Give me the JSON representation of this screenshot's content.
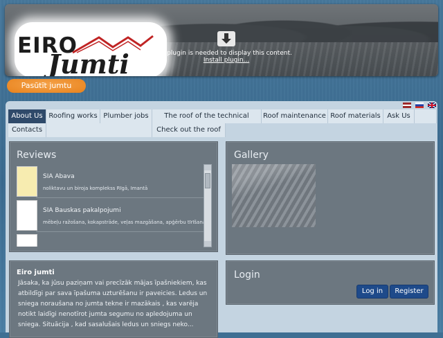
{
  "header": {
    "logo_top": "EIRO",
    "logo_bottom": "Jumti",
    "plugin_message": "A plugin is needed to display this content.",
    "plugin_link": "Install plugin..."
  },
  "order_button": "Pasūtīt jumtu",
  "languages": [
    "lv",
    "ru",
    "en"
  ],
  "nav": {
    "row1": [
      "About Us",
      "Roofing works",
      "Plumber jobs",
      "The roof of the technical survey",
      "Roof maintenance",
      "Roof materials",
      "Ask Us"
    ],
    "row2": [
      "Contacts",
      "Check out the roof"
    ]
  },
  "reviews": {
    "title": "Reviews",
    "items": [
      {
        "name": "SIA Abava",
        "desc": "noliktavu un biroja komplekss Rīgā, Imantā"
      },
      {
        "name": "SIA Bauskas pakalpojumi",
        "desc": "mēbeļu ražošana, kokapstrāde, veļas mazgāšana, apģērbu tīrīšana"
      }
    ]
  },
  "gallery": {
    "title": "Gallery"
  },
  "login": {
    "title": "Login",
    "login_label": "Log in",
    "register_label": "Register"
  },
  "about": {
    "title": "Eiro jumti",
    "text": "Jāsaka, ka jūsu paziņam vai precīzāk mājas īpašniekiem, kas atbildīgi par sava īpašuma uzturēšanu ir paveicies.  Ledus un sniega noraušana no jumta tekne ir  mazākais , kas varēja notikt laidīgi nenotīrot jumta segumu no apledojuma un sniega. Situācija , kad sasalušais ledus un sniegs neko..."
  },
  "colors": {
    "nav_active": "#2f4a6a",
    "order_button": "#e8821c",
    "login_buttons": "#1e4a8a"
  }
}
